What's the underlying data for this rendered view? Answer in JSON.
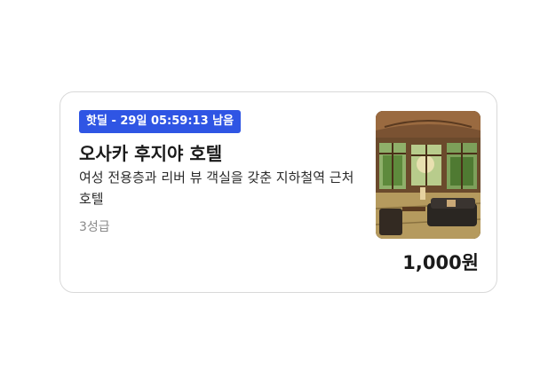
{
  "product": {
    "deal_badge": "핫딜 - 29일 05:59:13 남음",
    "title": "오사카 후지야 호텔",
    "description": "여성 전용층과 리버 뷰 객실을 갖춘 지하철역 근처 호텔",
    "grade": "3성급",
    "price": "1,000원",
    "image_name": "hotel-room-photo",
    "accent_color": "#2f55e4"
  }
}
